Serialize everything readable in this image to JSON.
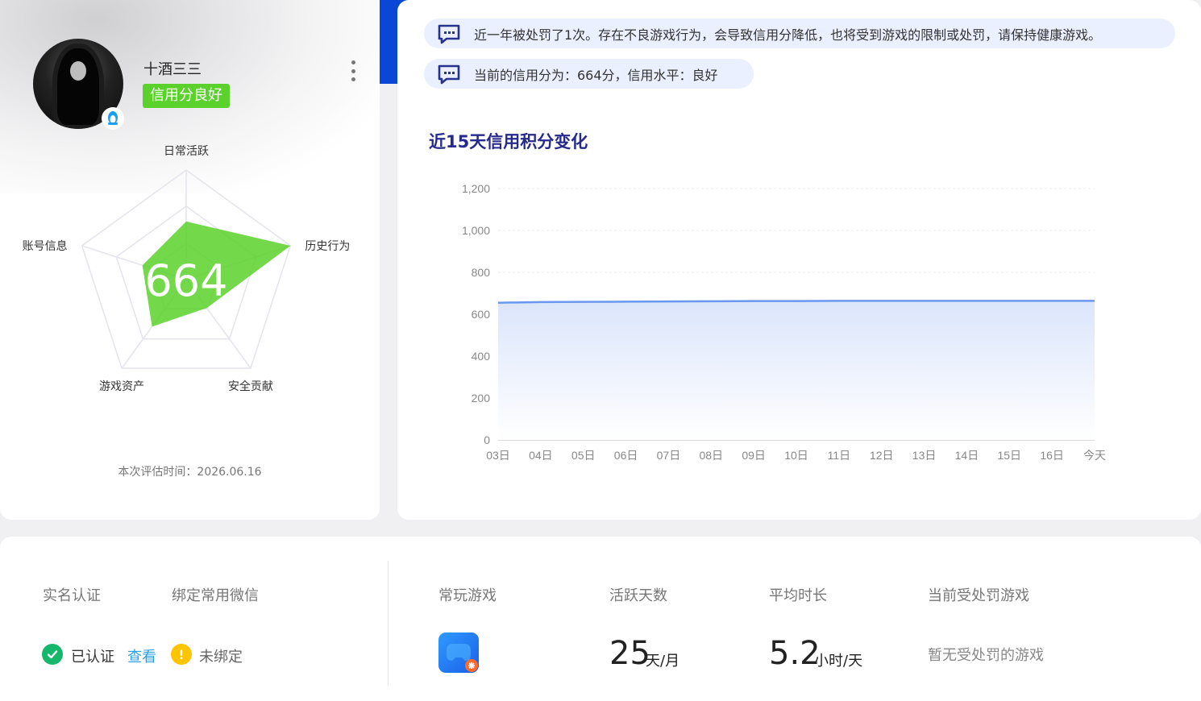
{
  "profile": {
    "username": "十酒三三",
    "credit_badge": "信用分良好",
    "score": "664",
    "eval_time": "本次评估时间：2026.06.16",
    "radar": {
      "axes": [
        "日常活跃",
        "历史行为",
        "安全贡献",
        "游戏资产",
        "账号信息"
      ],
      "values": [
        0.53,
        1.0,
        0.32,
        0.53,
        0.42
      ],
      "fill_color": "#5bd22c"
    }
  },
  "notices": [
    {
      "text": "近一年被处罚了1次。存在不良游戏行为，会导致信用分降低，也将受到游戏的限制或处罚，请保持健康游戏。"
    },
    {
      "text": "当前的信用分为：664分，信用水平：良好"
    }
  ],
  "chart_data": {
    "type": "area",
    "title": "近15天信用积分变化",
    "x": [
      "03日",
      "04日",
      "05日",
      "06日",
      "07日",
      "08日",
      "09日",
      "10日",
      "11日",
      "12日",
      "13日",
      "14日",
      "15日",
      "16日",
      "今天"
    ],
    "y_ticks": [
      "0",
      "200",
      "400",
      "800",
      "600",
      "1,000",
      "1,200"
    ],
    "ylim": [
      0,
      1200
    ],
    "series": [
      {
        "values": [
          655,
          658,
          659,
          660,
          661,
          662,
          663,
          663,
          664,
          664,
          664,
          664,
          664,
          664,
          664
        ]
      }
    ],
    "line_color": "#6a98ef",
    "grid": true
  },
  "bottom": {
    "realname_label": "实名认证",
    "wechat_label": "绑定常用微信",
    "realname_status": "已认证",
    "view_link": "查看",
    "wechat_status": "未绑定",
    "frequent_game_label": "常玩游戏",
    "active_days_label": "活跃天数",
    "avg_time_label": "平均时长",
    "punished_label": "当前受处罚游戏",
    "active_days_value": "25",
    "active_days_unit": "天/月",
    "avg_time_value": "5.2",
    "avg_time_unit": "小时/天",
    "punished_value": "暂无受处罚的游戏"
  }
}
